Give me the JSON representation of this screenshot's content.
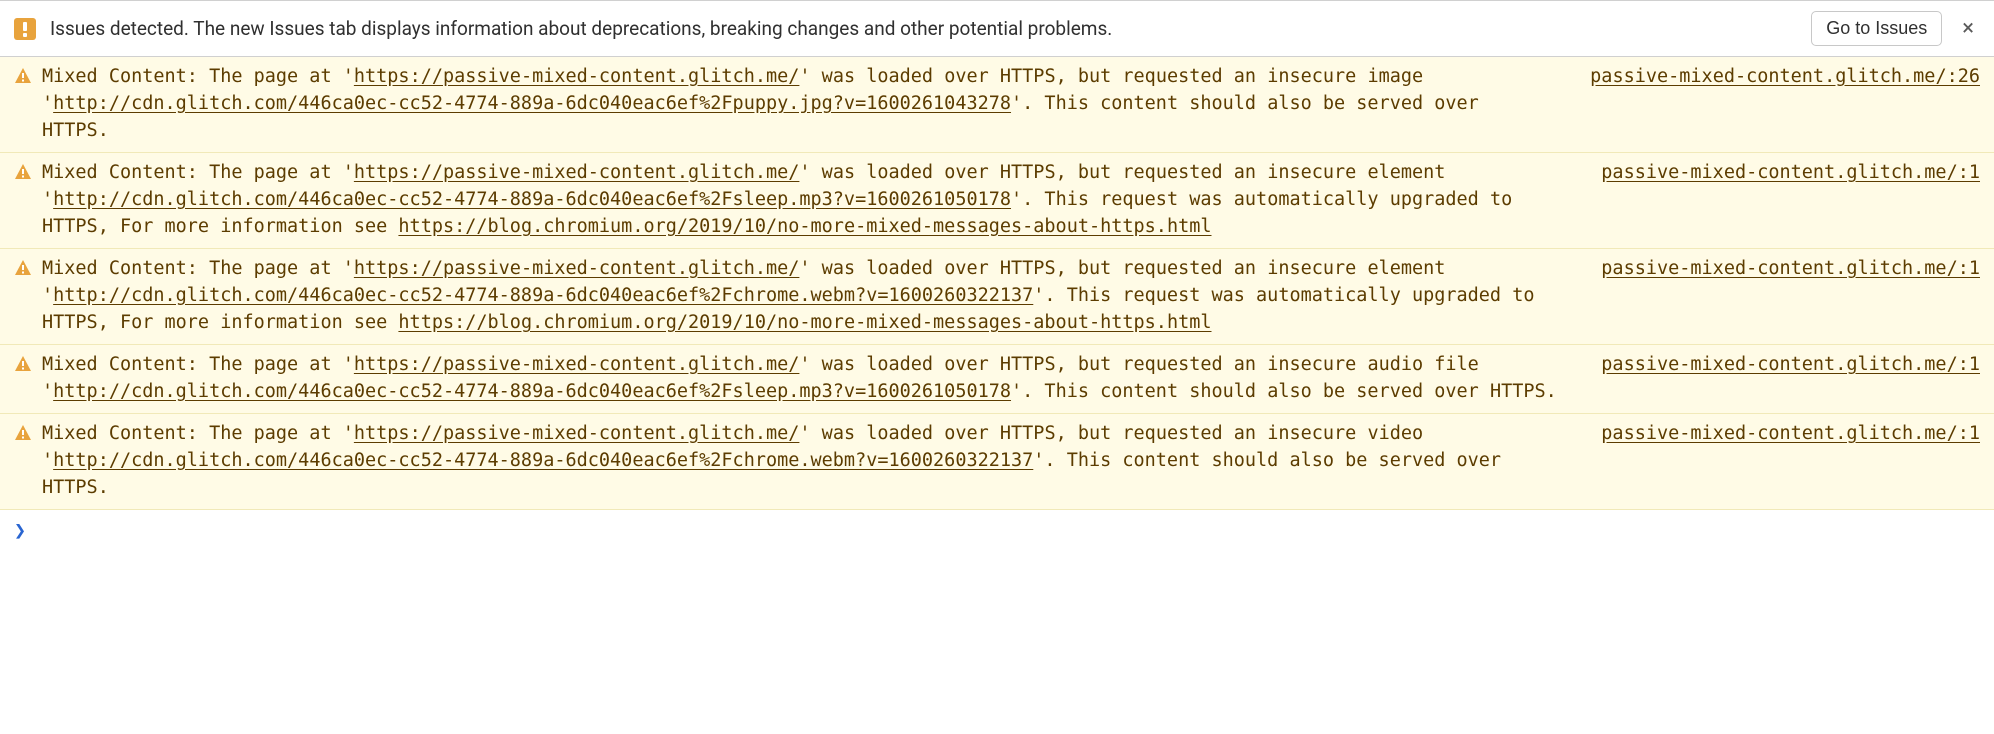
{
  "bar": {
    "message": "Issues detected. The new Issues tab displays information about deprecations, breaking changes and other potential problems.",
    "button": "Go to Issues",
    "close": "×"
  },
  "warnings": [
    {
      "source": "passive-mixed-content.glitch.me/:26",
      "t0": "Mixed Content: The page at '",
      "l0": "https://passive-mixed-content.glitch.me/",
      "t1": "' was loaded over HTTPS, but requested an insecure image '",
      "l1": "http://cdn.glitch.com/446ca0ec-cc52-4774-889a-6dc040eac6ef%2Fpuppy.jpg?v=1600261043278",
      "t2": "'. This content should also be served over HTTPS.",
      "l2": "",
      "t3": ""
    },
    {
      "source": "passive-mixed-content.glitch.me/:1",
      "t0": "Mixed Content: The page at '",
      "l0": "https://passive-mixed-content.glitch.me/",
      "t1": "' was loaded over HTTPS, but requested an insecure element '",
      "l1": "http://cdn.glitch.com/446ca0ec-cc52-4774-889a-6dc040eac6ef%2Fsleep.mp3?v=1600261050178",
      "t2": "'. This request was automatically upgraded to HTTPS, For more information see ",
      "l2": "https://blog.chromium.org/2019/10/no-more-mixed-messages-about-https.html",
      "t3": ""
    },
    {
      "source": "passive-mixed-content.glitch.me/:1",
      "t0": "Mixed Content: The page at '",
      "l0": "https://passive-mixed-content.glitch.me/",
      "t1": "' was loaded over HTTPS, but requested an insecure element '",
      "l1": "http://cdn.glitch.com/446ca0ec-cc52-4774-889a-6dc040eac6ef%2Fchrome.webm?v=1600260322137",
      "t2": "'. This request was automatically upgraded to HTTPS, For more information see ",
      "l2": "https://blog.chromium.org/2019/10/no-more-mixed-messages-about-https.html",
      "t3": ""
    },
    {
      "source": "passive-mixed-content.glitch.me/:1",
      "t0": "Mixed Content: The page at '",
      "l0": "https://passive-mixed-content.glitch.me/",
      "t1": "' was loaded over HTTPS, but requested an insecure audio file '",
      "l1": "http://cdn.glitch.com/446ca0ec-cc52-4774-889a-6dc040eac6ef%2Fsleep.mp3?v=1600261050178",
      "t2": "'. This content should also be served over HTTPS.",
      "l2": "",
      "t3": ""
    },
    {
      "source": "passive-mixed-content.glitch.me/:1",
      "t0": "Mixed Content: The page at '",
      "l0": "https://passive-mixed-content.glitch.me/",
      "t1": "' was loaded over HTTPS, but requested an insecure video '",
      "l1": "http://cdn.glitch.com/446ca0ec-cc52-4774-889a-6dc040eac6ef%2Fchrome.webm?v=1600260322137",
      "t2": "'. This content should also be served over HTTPS.",
      "l2": "",
      "t3": ""
    }
  ],
  "prompt": "❯"
}
